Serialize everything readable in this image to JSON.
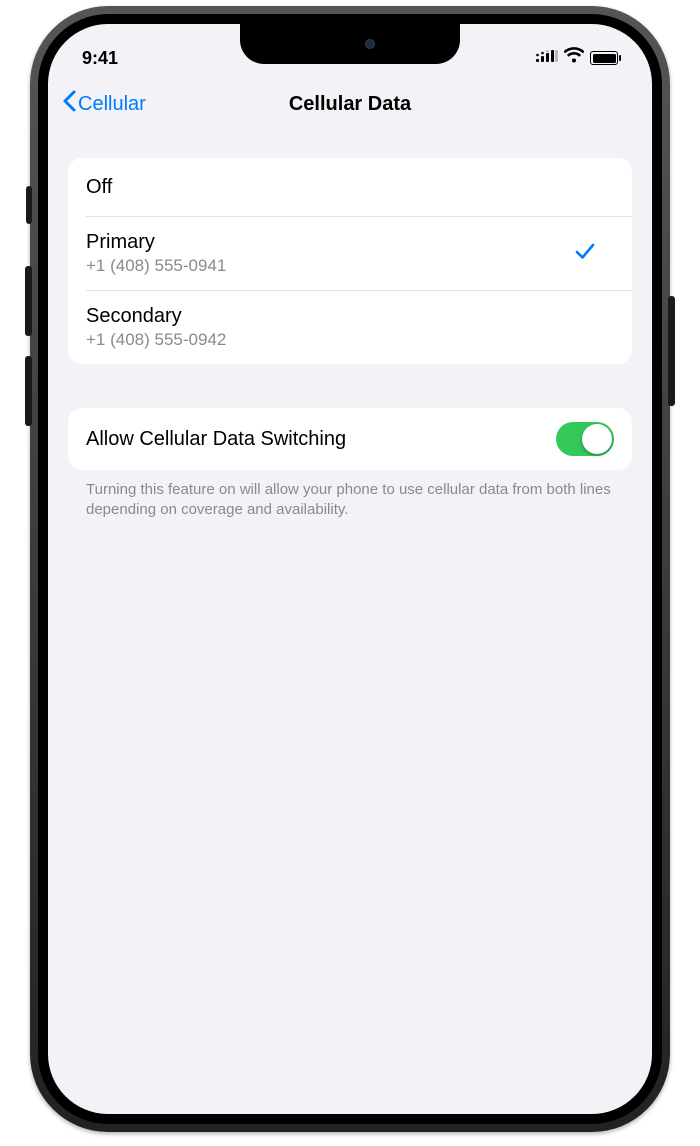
{
  "status": {
    "time": "9:41"
  },
  "nav": {
    "back": "Cellular",
    "title": "Cellular Data"
  },
  "lines": {
    "off": "Off",
    "primary": {
      "label": "Primary",
      "number": "+1 (408) 555-0941",
      "selected": true
    },
    "secondary": {
      "label": "Secondary",
      "number": "+1 (408) 555-0942",
      "selected": false
    }
  },
  "switching": {
    "label": "Allow Cellular Data Switching",
    "on": true,
    "note": "Turning this feature on will allow your phone to use cellular data from both lines depending on coverage and availability."
  }
}
